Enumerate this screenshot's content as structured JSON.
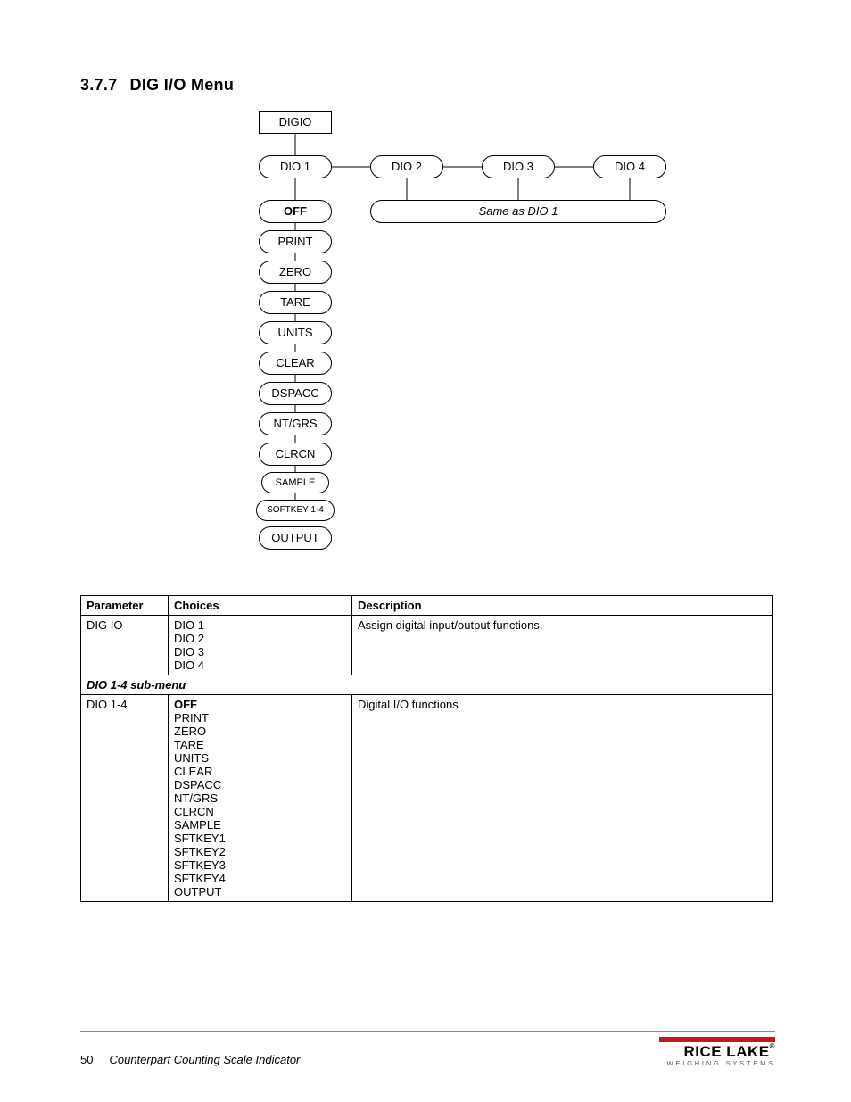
{
  "heading": {
    "number": "3.7.7",
    "title": "DIG I/O Menu"
  },
  "diagram": {
    "root": "DIGIO",
    "dio_labels": [
      "DIO 1",
      "DIO 2",
      "DIO 3",
      "DIO 4"
    ],
    "same_as": "Same as DIO 1",
    "options": [
      "OFF",
      "PRINT",
      "ZERO",
      "TARE",
      "UNITS",
      "CLEAR",
      "DSPACC",
      "NT/GRS",
      "CLRCN",
      "SAMPLE",
      "SOFTKEY 1-4",
      "OUTPUT"
    ]
  },
  "table": {
    "headers": [
      "Parameter",
      "Choices",
      "Description"
    ],
    "row1": {
      "param": "DIG IO",
      "choices": [
        "DIO 1",
        "DIO 2",
        "DIO 3",
        "DIO 4"
      ],
      "desc": "Assign digital input/output functions."
    },
    "submenu_label": "DIO 1-4 sub-menu",
    "row2": {
      "param": "DIO 1-4",
      "choices": [
        "OFF",
        "PRINT",
        "ZERO",
        "TARE",
        "UNITS",
        "CLEAR",
        "DSPACC",
        "NT/GRS",
        "CLRCN",
        "SAMPLE",
        "SFTKEY1",
        "SFTKEY2",
        "SFTKEY3",
        "SFTKEY4",
        "OUTPUT"
      ],
      "desc": "Digital I/O functions"
    }
  },
  "footer": {
    "page": "50",
    "doc": "Counterpart Counting Scale Indicator",
    "logo_name": "RICE LAKE",
    "logo_sub": "WEIGHING SYSTEMS"
  }
}
